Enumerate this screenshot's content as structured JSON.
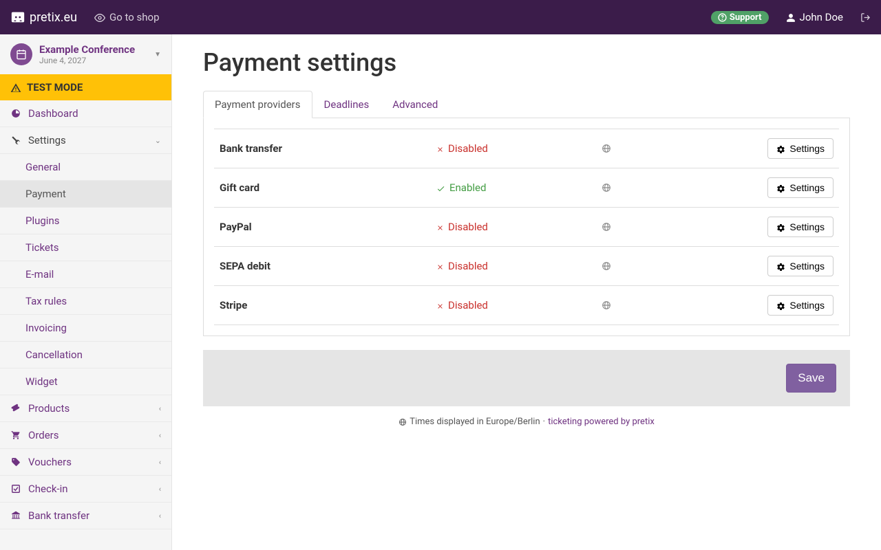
{
  "brand": "pretix.eu",
  "gotoshop": "Go to shop",
  "support": "Support",
  "user": "John Doe",
  "event": {
    "name": "Example Conference",
    "date": "June 4, 2027"
  },
  "testmode": "TEST MODE",
  "nav": {
    "dashboard": "Dashboard",
    "settings": "Settings",
    "settings_sub": {
      "general": "General",
      "payment": "Payment",
      "plugins": "Plugins",
      "tickets": "Tickets",
      "email": "E-mail",
      "taxrules": "Tax rules",
      "invoicing": "Invoicing",
      "cancellation": "Cancellation",
      "widget": "Widget"
    },
    "products": "Products",
    "orders": "Orders",
    "vouchers": "Vouchers",
    "checkin": "Check-in",
    "banktransfer": "Bank transfer"
  },
  "page_title": "Payment settings",
  "tabs": {
    "providers": "Payment providers",
    "deadlines": "Deadlines",
    "advanced": "Advanced"
  },
  "status": {
    "enabled": "Enabled",
    "disabled": "Disabled"
  },
  "providers": [
    {
      "name": "Bank transfer",
      "enabled": false
    },
    {
      "name": "Gift card",
      "enabled": true
    },
    {
      "name": "PayPal",
      "enabled": false
    },
    {
      "name": "SEPA debit",
      "enabled": false
    },
    {
      "name": "Stripe",
      "enabled": false
    }
  ],
  "settings_btn": "Settings",
  "save": "Save",
  "footer": {
    "tz": "Times displayed in Europe/Berlin",
    "sep": " · ",
    "powered": "ticketing powered by pretix"
  }
}
